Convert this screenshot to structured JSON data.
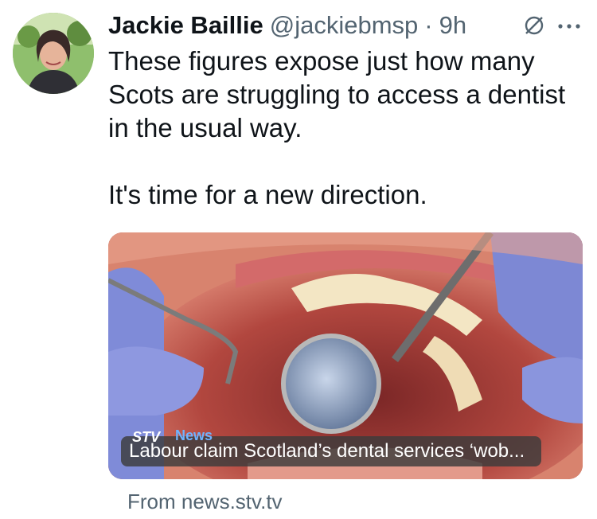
{
  "author": {
    "name": "Jackie Baillie",
    "handle": "@jackiebmsp",
    "separator": "·",
    "time": "9h"
  },
  "icons": {
    "grok": "grok-icon",
    "more": "more-horizontal-icon"
  },
  "tweet": {
    "text": "These figures expose just how many\nScots are struggling to access a dentist\nin the usual way.\n\nIt's time for a new direction."
  },
  "card": {
    "logo": "STV",
    "logo_sub": "News",
    "headline": "Labour claim Scotland’s dental services ‘wob...",
    "source": "From news.stv.tv"
  }
}
